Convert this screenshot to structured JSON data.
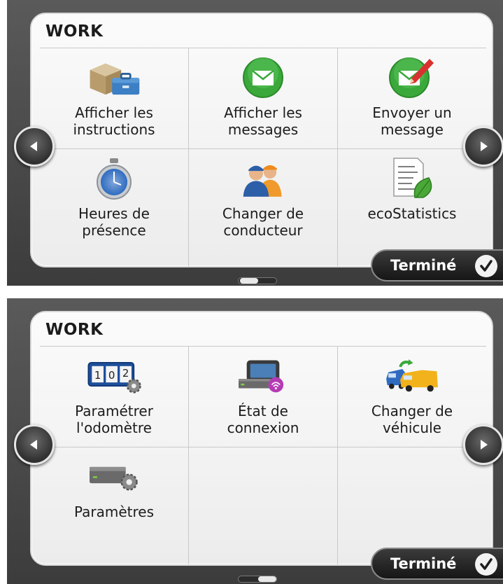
{
  "screens": [
    {
      "title": "WORK",
      "items": [
        {
          "label": "Afficher les\ninstructions",
          "icon": "toolbox-package-icon"
        },
        {
          "label": "Afficher les\nmessages",
          "icon": "envelope-green-icon"
        },
        {
          "label": "Envoyer un\nmessage",
          "icon": "envelope-pencil-icon"
        },
        {
          "label": "Heures de\nprésence",
          "icon": "stopwatch-icon"
        },
        {
          "label": "Changer de\nconducteur",
          "icon": "drivers-icon"
        },
        {
          "label": "ecoStatistics",
          "icon": "eco-document-leaf-icon"
        }
      ],
      "done_label": "Terminé",
      "page": 1
    },
    {
      "title": "WORK",
      "items": [
        {
          "label": "Paramétrer\nl'odomètre",
          "icon": "odometer-gear-icon"
        },
        {
          "label": "État de\nconnexion",
          "icon": "device-wireless-icon"
        },
        {
          "label": "Changer de\nvéhicule",
          "icon": "vans-swap-icon"
        },
        {
          "label": "Paramètres",
          "icon": "device-gear-icon"
        }
      ],
      "done_label": "Terminé",
      "page": 2
    }
  ],
  "colors": {
    "accent_green": "#3aa83a",
    "panel_bg": "#f4f4f4",
    "frame_dark": "#3c3c3c"
  }
}
